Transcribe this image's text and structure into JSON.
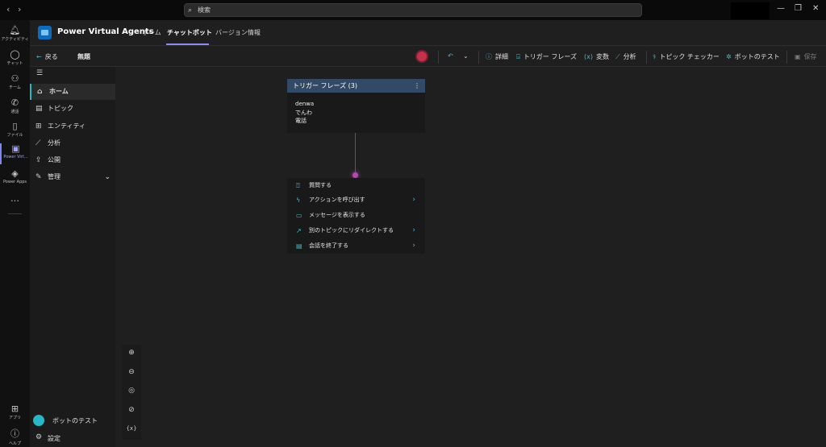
{
  "titlebar": {
    "back": "‹",
    "forward": "›",
    "search_placeholder": "検索",
    "minimize": "—",
    "maximize": "❐",
    "close": "✕"
  },
  "rail": [
    {
      "label": "アクティビティ",
      "icon": "bell-icon"
    },
    {
      "label": "チャット",
      "icon": "chat-icon"
    },
    {
      "label": "チーム",
      "icon": "teams-icon"
    },
    {
      "label": "通話",
      "icon": "phone-icon"
    },
    {
      "label": "ファイル",
      "icon": "file-icon"
    },
    {
      "label": "Power Virt...",
      "icon": "power-virtual-agents-icon"
    },
    {
      "label": "Power Apps",
      "icon": "power-apps-icon"
    },
    {
      "label": "…",
      "icon": "more-icon"
    },
    {
      "label": "アプリ",
      "icon": "apps-icon"
    },
    {
      "label": "ヘルプ",
      "icon": "help-icon"
    }
  ],
  "header": {
    "app_name": "Power Virtual Agents",
    "tabs": [
      "ホーム",
      "チャットボット",
      "バージョン情報"
    ]
  },
  "toolbar": {
    "back": "戻る",
    "topic_name": "無題",
    "details": "詳細",
    "trigger_phrases": "トリガー フレーズ",
    "variables": "変数",
    "analytics": "分析",
    "topic_checker": "トピック チェッカー",
    "test_bot": "ボットのテスト",
    "save": "保存"
  },
  "leftnav": {
    "items": [
      {
        "label": "ホーム",
        "icon": "home-icon"
      },
      {
        "label": "トピック",
        "icon": "topic-icon"
      },
      {
        "label": "エンティティ",
        "icon": "entity-icon"
      },
      {
        "label": "分析",
        "icon": "chart-icon"
      },
      {
        "label": "公開",
        "icon": "publish-icon"
      },
      {
        "label": "管理",
        "icon": "manage-icon"
      }
    ],
    "test_bot": "ボットのテスト",
    "settings": "設定"
  },
  "trigger_card": {
    "title": "トリガー フレーズ (3)",
    "phrases": [
      "denwa",
      "でんわ",
      "電話"
    ]
  },
  "action_menu": [
    "質問する",
    "アクションを呼び出す",
    "メッセージを表示する",
    "別のトピックにリダイレクトする",
    "会話を終了する"
  ],
  "zoom": {
    "variables_label": "{x}"
  },
  "colors": {
    "accent_teal": "#29b6c6",
    "accent_purple": "#8a8df0",
    "trigger_header": "#324a66",
    "connector_dot": "#b14bb0"
  }
}
